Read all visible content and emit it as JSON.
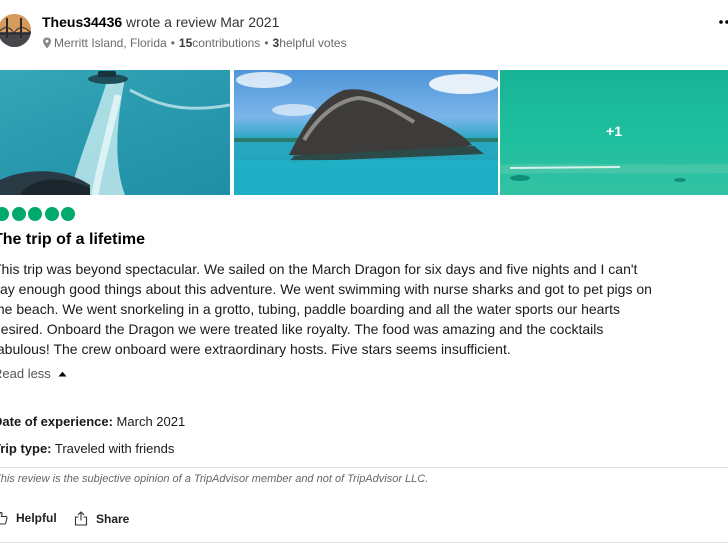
{
  "review": {
    "reviewer_name": "Theus34436",
    "action_text": " wrote a review Mar 2021",
    "location": "Merritt Island, Florida",
    "separator": "•",
    "contributions_count": "15",
    "contributions_label": " contributions",
    "helpful_count": "3",
    "helpful_label": " helpful votes",
    "photos": {
      "more_count": "+1"
    },
    "rating": 5,
    "title": "The trip of a lifetime",
    "body_lines": [
      "This trip was beyond spectacular. We sailed on the March Dragon for six days and five nights and I can't",
      "say enough good things about this adventure. We went swimming with nurse sharks and got to pet pigs on",
      "the beach. We went snorkeling in a grotto, tubing, paddle boarding and all the water sports our hearts",
      "desired. Onboard the Dragon we were treated like royalty. The food was amazing and the cocktails",
      "fabulous! The crew onboard were extraordinary hosts. Five stars seems insufficient."
    ],
    "read_less_label": "Read less",
    "date_of_experience_label": "Date of experience:",
    "date_of_experience_value": " March 2021",
    "trip_type_label": "Trip type:",
    "trip_type_value": " Traveled with friends",
    "disclaimer": "This review is the subjective opinion of a TripAdvisor member and not of TripAdvisor LLC.",
    "helpful_button_label": "Helpful",
    "share_button_label": "Share"
  },
  "colors": {
    "rating_bubble": "#00aa6c",
    "text_primary": "#000000",
    "text_secondary": "#6a6a6a",
    "divider": "#e0e0e0"
  },
  "icons": {
    "location": "pin-icon",
    "more": "more-dots-icon",
    "helpful": "thumbs-up-icon",
    "share": "share-icon",
    "read_less": "caret-up-icon"
  }
}
